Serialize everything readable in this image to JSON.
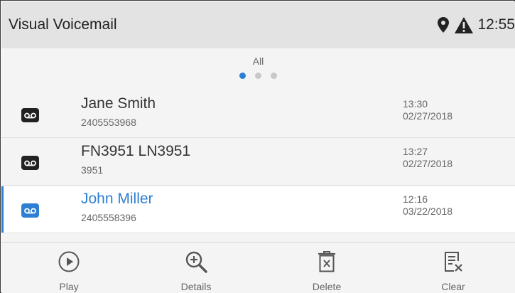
{
  "header": {
    "title": "Visual Voicemail",
    "time": "12:55",
    "icons": [
      "location-pin-icon",
      "warning-icon"
    ]
  },
  "filter": {
    "label": "All",
    "page_count": 3,
    "active_page": 1
  },
  "messages": [
    {
      "name": "Jane Smith",
      "number": "2405553968",
      "time": "13:30",
      "date": "02/27/2018",
      "selected": false
    },
    {
      "name": "FN3951 LN3951",
      "number": "3951",
      "time": "13:27",
      "date": "02/27/2018",
      "selected": false
    },
    {
      "name": "John Miller",
      "number": "2405558396",
      "time": "12:16",
      "date": "03/22/2018",
      "selected": true
    }
  ],
  "toolbar": {
    "play_label": "Play",
    "details_label": "Details",
    "delete_label": "Delete",
    "clear_label": "Clear"
  },
  "colors": {
    "accent": "#2e7fd2",
    "header_bg": "#e3e3e3",
    "list_bg": "#f4f4f4",
    "text": "#333333",
    "muted": "#666666"
  }
}
